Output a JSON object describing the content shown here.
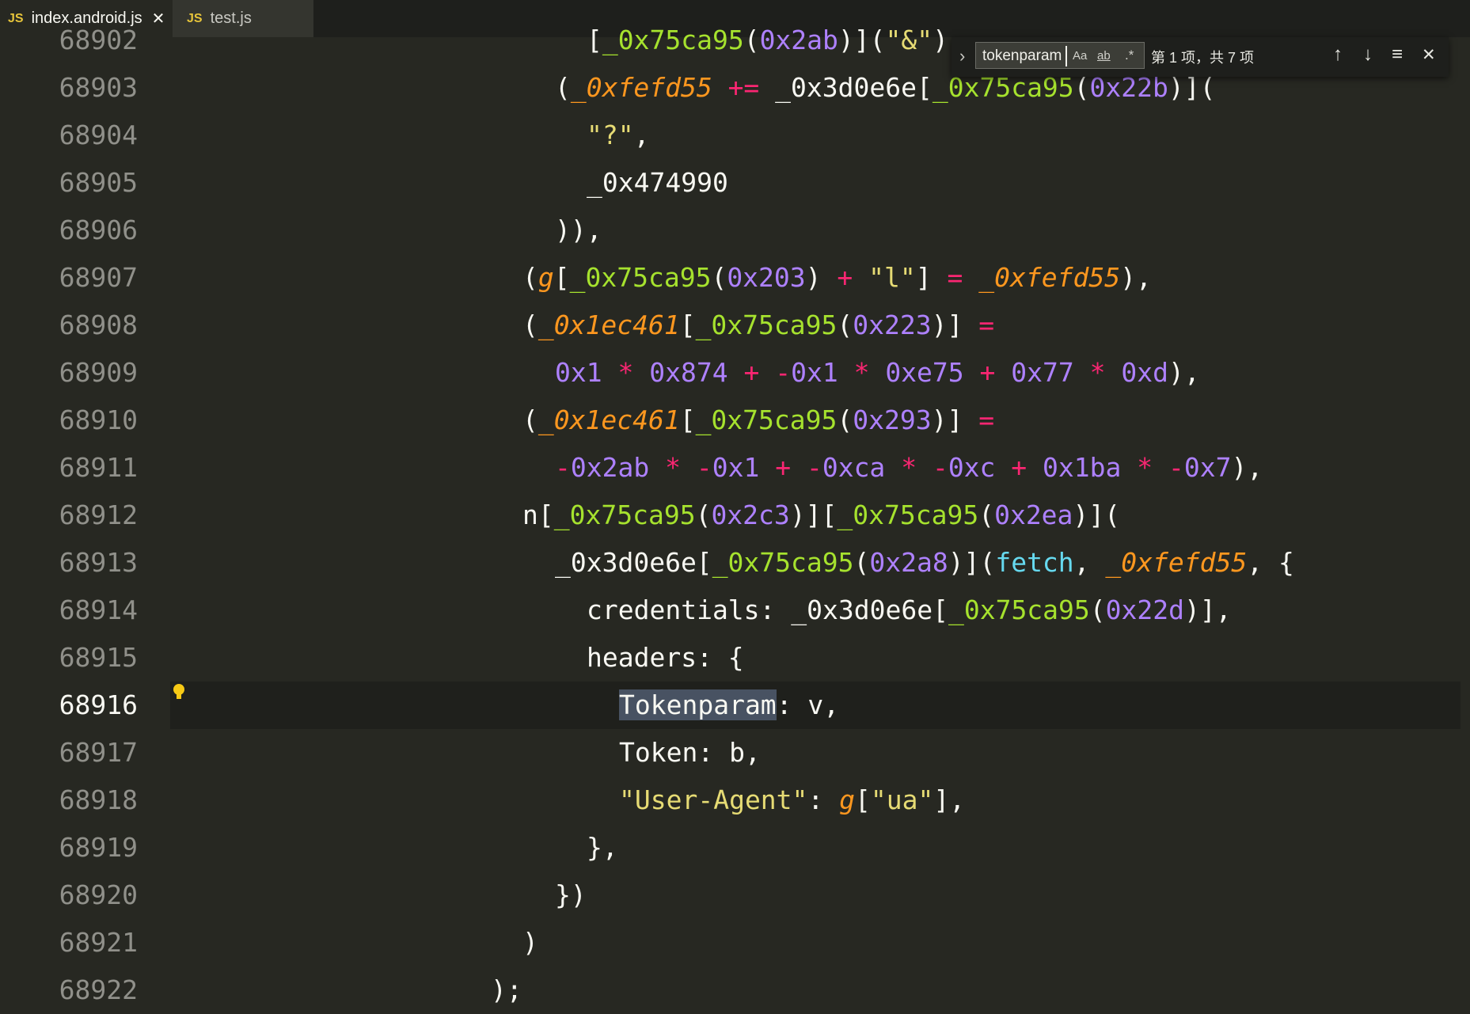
{
  "tabs": [
    {
      "badge": "JS",
      "label": "index.android.js",
      "close": "✕"
    },
    {
      "badge": "JS",
      "label": "test.js"
    }
  ],
  "find": {
    "toggle": "›",
    "query": "tokenparam",
    "match_case": "Aa",
    "whole_word": "ab",
    "regex": ".*",
    "result_text": "第 1 项，共 7 项",
    "prev": "↑",
    "next": "↓",
    "in_selection": "≡",
    "close": "✕"
  },
  "lines": [
    {
      "n": "68902",
      "text": "[_0x75ca95(0x2ab)](\"&\"),"
    },
    {
      "n": "68903",
      "text": "(_0xfefd55 += _0x3d0e6e[_0x75ca95(0x22b)]("
    },
    {
      "n": "68904",
      "text": "\"?\","
    },
    {
      "n": "68905",
      "text": "_0x474990"
    },
    {
      "n": "68906",
      "text": ")),"
    },
    {
      "n": "68907",
      "text": "(g[_0x75ca95(0x203) + \"l\"] = _0xfefd55),"
    },
    {
      "n": "68908",
      "text": "(_0x1ec461[_0x75ca95(0x223)] ="
    },
    {
      "n": "68909",
      "text": "0x1 * 0x874 + -0x1 * 0xe75 + 0x77 * 0xd),"
    },
    {
      "n": "68910",
      "text": "(_0x1ec461[_0x75ca95(0x293)] ="
    },
    {
      "n": "68911",
      "text": "-0x2ab * -0x1 + -0xca * -0xc + 0x1ba * -0x7),"
    },
    {
      "n": "68912",
      "text": "n[_0x75ca95(0x2c3)][_0x75ca95(0x2ea)]("
    },
    {
      "n": "68913",
      "text": "_0x3d0e6e[_0x75ca95(0x2a8)](fetch, _0xfefd55, {"
    },
    {
      "n": "68914",
      "text": "credentials: _0x3d0e6e[_0x75ca95(0x22d)],"
    },
    {
      "n": "68915",
      "text": "headers: {"
    },
    {
      "n": "68916",
      "text": "Tokenparam: v,",
      "current": true
    },
    {
      "n": "68917",
      "text": "Token: b,"
    },
    {
      "n": "68918",
      "text": "\"User-Agent\": g[\"ua\"],"
    },
    {
      "n": "68919",
      "text": "},"
    },
    {
      "n": "68920",
      "text": "})"
    },
    {
      "n": "68921",
      "text": ")"
    },
    {
      "n": "68922",
      "text": ");"
    }
  ],
  "colors": {
    "background": "#272822",
    "number": "#ae81ff",
    "string": "#e6db74",
    "operator": "#f92672",
    "function": "#a6e22e",
    "parameter": "#fd971f",
    "builtin": "#66d9ef",
    "match_highlight": "#485262"
  }
}
